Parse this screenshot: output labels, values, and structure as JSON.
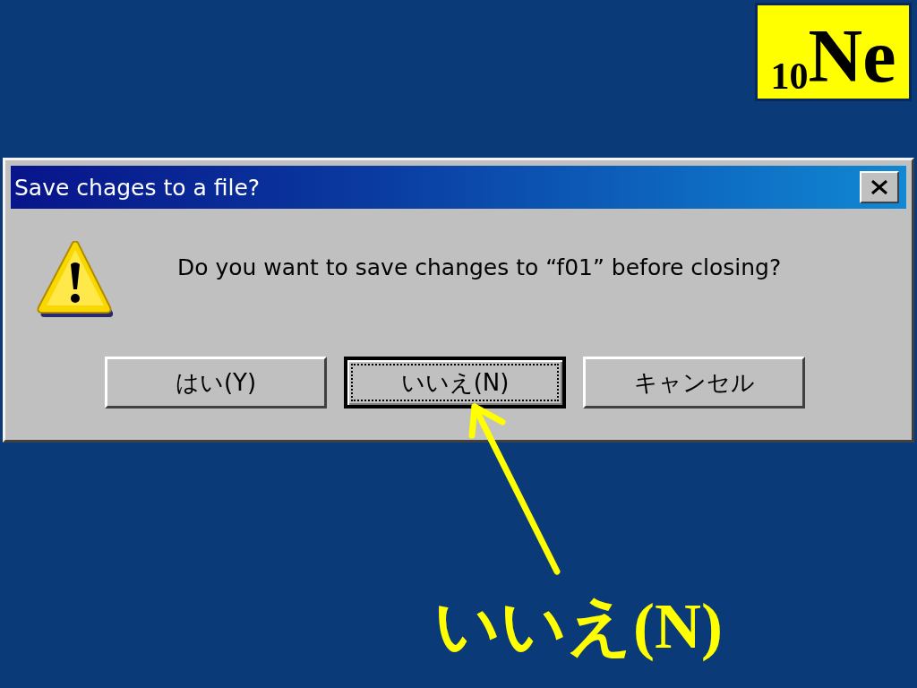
{
  "badge": {
    "element": "$_{10}$Ne"
  },
  "dialog": {
    "title": "Save chages to a file?",
    "message": "Do you want to save changes to “f01” before closing?",
    "buttons": [
      {
        "label": "はい(Y)",
        "selected": false
      },
      {
        "label": "いいえ(N)",
        "selected": true
      },
      {
        "label": "キャンセル",
        "selected": false
      }
    ]
  },
  "caption": "いいえ(N)"
}
